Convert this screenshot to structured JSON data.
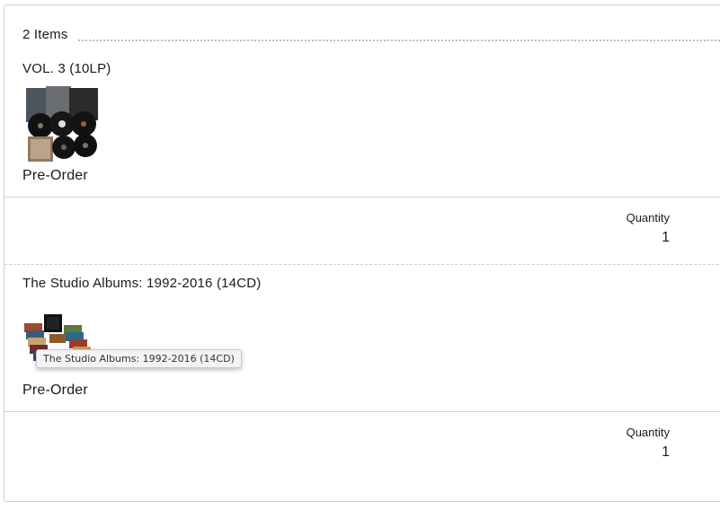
{
  "cart": {
    "item_count": "2 Items",
    "items": [
      {
        "title": "VOL. 3 (10LP)",
        "status": "Pre-Order",
        "quantity_label": "Quantity",
        "quantity": "1"
      },
      {
        "title": "The Studio Albums: 1992-2016 (14CD)",
        "status": "Pre-Order",
        "quantity_label": "Quantity",
        "quantity": "1"
      }
    ]
  },
  "tooltip": {
    "text": "The Studio Albums: 1992-2016 (14CD)"
  }
}
